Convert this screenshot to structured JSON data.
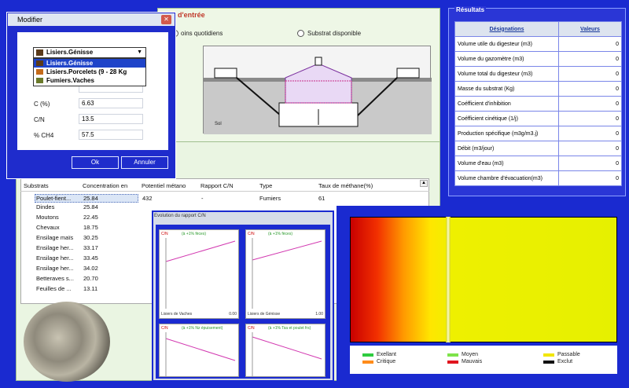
{
  "input": {
    "title": "d'entrée",
    "radio1": "oins quotidiens",
    "radio2": "Substrat disponible",
    "diagram_label": "Sol"
  },
  "results": {
    "title": "Résultats",
    "col_designation": "Désignations",
    "col_values": "Valeurs",
    "rows": [
      {
        "label": "Volume utile du digesteur (m3)",
        "value": "0"
      },
      {
        "label": "Volume du gazomètre (m3)",
        "value": "0"
      },
      {
        "label": "Volume total du digesteur (m3)",
        "value": "0"
      },
      {
        "label": "Masse du substrat (Kg)",
        "value": "0"
      },
      {
        "label": "Coéfficient d'inhibition",
        "value": "0"
      },
      {
        "label": "Coéfficient cinétique (1/j)",
        "value": "0"
      },
      {
        "label": "Production spécifique (m3g/m3.j)",
        "value": "0"
      },
      {
        "label": "Débit (m3/jour)",
        "value": "0"
      },
      {
        "label": "Volume d'eau (m3)",
        "value": "0"
      },
      {
        "label": "Volume chambre d'évacuation(m3)",
        "value": "0"
      }
    ]
  },
  "substrates": {
    "headers": [
      "Substrats",
      "Concentration en",
      "Potentiel métano",
      "Rapport C/N",
      "Type",
      "Taux de méthane(%)"
    ],
    "selected": {
      "name": "Poulet-fient...",
      "conc": "25.84",
      "potential": "432",
      "ratio": "-",
      "type": "Fumiers",
      "methane": "61"
    },
    "rows": [
      {
        "name": "Dindes",
        "conc": "25.84"
      },
      {
        "name": "Moutons",
        "conc": "22.45"
      },
      {
        "name": "Chevaux",
        "conc": "18.75"
      },
      {
        "name": "Ensilage maïs",
        "conc": "30.25"
      },
      {
        "name": "Ensilage her...",
        "conc": "33.17"
      },
      {
        "name": "Ensilage her...",
        "conc": "33.45"
      },
      {
        "name": "Ensilage her...",
        "conc": "34.02"
      },
      {
        "name": "Betteraves s...",
        "conc": "20.70"
      },
      {
        "name": "Feuilles de ...",
        "conc": "13.11"
      }
    ]
  },
  "graph": {
    "title": "Evolution du rapport C/N",
    "panels": [
      {
        "axis": "C/N",
        "label": "(à +1% fèces)",
        "foot": "Lisiers de Vaches",
        "foot_val": "0.00"
      },
      {
        "axis": "C/N",
        "label": "(à +1% fèces)",
        "foot": "Lisiers de Génisse",
        "foot_val": "1.00"
      },
      {
        "axis": "C/N",
        "label": "(à +1% Nz épuisement)",
        "foot": "",
        "foot_val": ""
      },
      {
        "axis": "C/N",
        "label": "(à +1% Tsa et poulet frs)",
        "foot": "",
        "foot_val": ""
      }
    ]
  },
  "legend": [
    {
      "label": "Exellant",
      "color": "#2ecc40"
    },
    {
      "label": "Moyen",
      "color": "#7ee34a"
    },
    {
      "label": "Passable",
      "color": "#f2e600"
    },
    {
      "label": "Critique",
      "color": "#ff8c1a"
    },
    {
      "label": "Mauvais",
      "color": "#e0141e"
    },
    {
      "label": "Exclut",
      "color": "#111111"
    }
  ],
  "dialog": {
    "title": "Modifier",
    "selected_option": "Lisiers.Génisse",
    "options": [
      "Lisiers.Génisse",
      "Lisiers.Porcelets (9 - 28 Kg",
      "Fumiers.Vaches"
    ],
    "fields": [
      {
        "label": "C (%)",
        "value": "6.63"
      },
      {
        "label": "C/N",
        "value": "13.5"
      },
      {
        "label": "% CH4",
        "value": "57.5"
      }
    ],
    "ok_label": "Ok",
    "cancel_label": "Annuler"
  }
}
